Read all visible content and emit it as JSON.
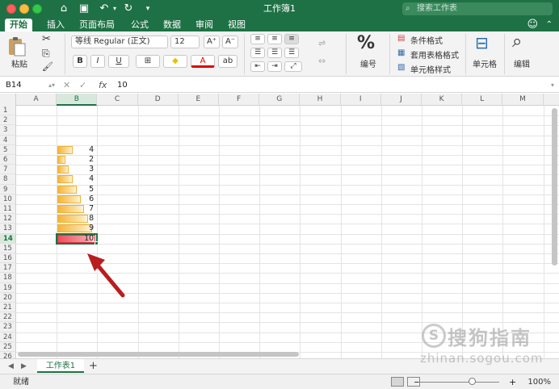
{
  "window": {
    "title": "工作簿1"
  },
  "search": {
    "placeholder": "搜索工作表"
  },
  "tabs": [
    {
      "label": "开始",
      "active": true
    },
    {
      "label": "插入"
    },
    {
      "label": "页面布局"
    },
    {
      "label": "公式"
    },
    {
      "label": "数据"
    },
    {
      "label": "审阅"
    },
    {
      "label": "视图"
    }
  ],
  "ribbon": {
    "paste_label": "粘贴",
    "font_name": "等线 Regular (正文)",
    "font_size": "12",
    "bold": "B",
    "italic": "I",
    "underline": "U",
    "number_label": "编号",
    "cond_format": "条件格式",
    "table_format": "套用表格格式",
    "cell_style": "单元格样式",
    "cells_label": "单元格",
    "edit_label": "编辑",
    "percent": "%"
  },
  "formula": {
    "name_box": "B14",
    "fx": "fx",
    "value": "10"
  },
  "columns": [
    "A",
    "B",
    "C",
    "D",
    "E",
    "F",
    "G",
    "H",
    "I",
    "J",
    "K",
    "L",
    "M"
  ],
  "selected_column": "B",
  "rows": [
    "1",
    "2",
    "3",
    "4",
    "5",
    "6",
    "7",
    "8",
    "9",
    "10",
    "11",
    "12",
    "13",
    "14",
    "15",
    "16",
    "17",
    "18",
    "19",
    "20",
    "21",
    "22",
    "23",
    "24",
    "25",
    "26"
  ],
  "selected_row": "14",
  "cells": [
    {
      "row": 5,
      "value": "4",
      "fraction": 0.4
    },
    {
      "row": 6,
      "value": "2",
      "fraction": 0.2
    },
    {
      "row": 7,
      "value": "3",
      "fraction": 0.3
    },
    {
      "row": 8,
      "value": "4",
      "fraction": 0.4
    },
    {
      "row": 9,
      "value": "5",
      "fraction": 0.5
    },
    {
      "row": 10,
      "value": "6",
      "fraction": 0.6
    },
    {
      "row": 11,
      "value": "7",
      "fraction": 0.7
    },
    {
      "row": 12,
      "value": "8",
      "fraction": 0.8
    },
    {
      "row": 13,
      "value": "9",
      "fraction": 0.9
    },
    {
      "row": 14,
      "value": "10",
      "fraction": 1.0,
      "highlight": true
    }
  ],
  "colors": {
    "accent": "#1e7145",
    "databar": "#f5b43a",
    "highlight_bar": "#ef4d5a",
    "arrow": "#b81e1e"
  },
  "sheets": [
    {
      "label": "工作表1",
      "active": true
    }
  ],
  "statusbar": {
    "status": "就绪",
    "zoom": "100%"
  },
  "watermark": {
    "logo": "S",
    "cn": "搜狗指南",
    "en": "zhinan.sogou.com"
  }
}
